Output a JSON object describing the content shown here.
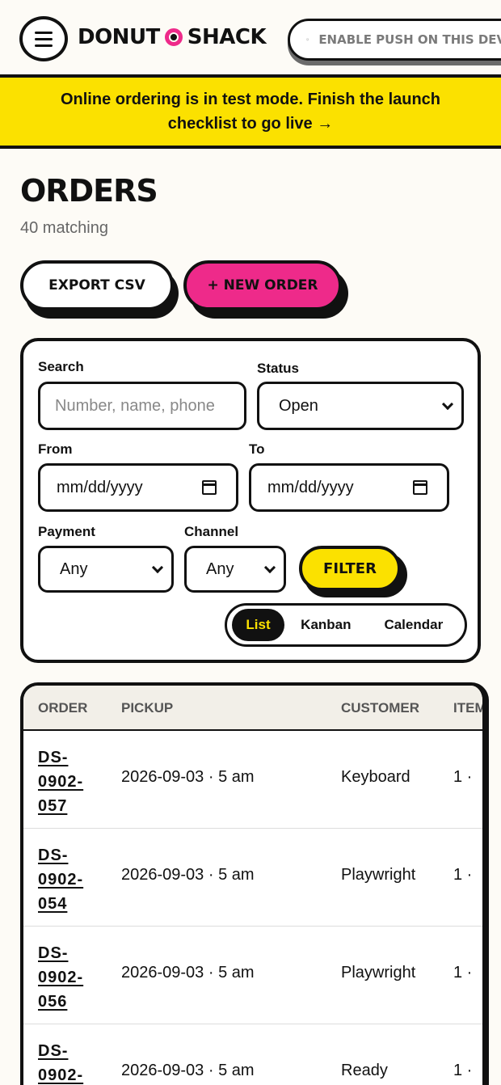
{
  "header": {
    "brand_left": "DONUT",
    "brand_right": "SHACK",
    "push_label": "ENABLE PUSH ON THIS DEVICE"
  },
  "banner": {
    "text": "Online ordering is in test mode. Finish the launch checklist to go live →"
  },
  "page": {
    "title": "ORDERS",
    "count": "40 matching"
  },
  "actions": {
    "export": "EXPORT CSV",
    "new_order": "+ NEW ORDER"
  },
  "filters": {
    "search_label": "Search",
    "search_placeholder": "Number, name, phone",
    "status_label": "Status",
    "status_value": "Open",
    "from_label": "From",
    "from_value": "mm/dd/yyyy",
    "to_label": "To",
    "to_value": "mm/dd/yyyy",
    "payment_label": "Payment",
    "payment_value": "Any",
    "channel_label": "Channel",
    "channel_value": "Any",
    "filter_button": "FILTER",
    "views": [
      "List",
      "Kanban",
      "Calendar"
    ],
    "active_view": "List"
  },
  "table": {
    "columns": [
      "ORDER",
      "PICKUP",
      "CUSTOMER",
      "ITEMS"
    ],
    "rows": [
      {
        "order": "DS-0902-057",
        "pickup": "2026-09-03 · 5 am",
        "customer": "Keyboard",
        "items": "1 ·"
      },
      {
        "order": "DS-0902-054",
        "pickup": "2026-09-03 · 5 am",
        "customer": "Playwright",
        "items": "1 ·"
      },
      {
        "order": "DS-0902-056",
        "pickup": "2026-09-03 · 5 am",
        "customer": "Playwright",
        "items": "1 ·"
      },
      {
        "order": "DS-0902-",
        "pickup": "2026-09-03 · 5 am",
        "customer": "Ready",
        "items": "1 ·"
      }
    ]
  },
  "colors": {
    "accent_pink": "#ee2a8a",
    "accent_yellow": "#fbe100",
    "ink": "#111111",
    "background": "#fdfbf6"
  }
}
